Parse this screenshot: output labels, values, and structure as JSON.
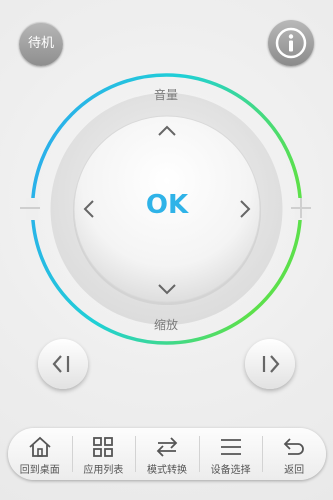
{
  "top": {
    "standby_label": "待机",
    "info_icon": "info-icon"
  },
  "dial": {
    "volume_label": "音量",
    "zoom_label": "缩放",
    "ok_label": "OK",
    "minus_icon": "minus-icon",
    "plus_icon": "plus-icon",
    "ring_colors": [
      "#2ea6f0",
      "#1fd0d6",
      "#5ce04b"
    ]
  },
  "controls": {
    "prev_icon": "prev-icon",
    "next_icon": "next-icon"
  },
  "bottom_nav": {
    "items": [
      {
        "label": "回到桌面",
        "icon": "home-icon"
      },
      {
        "label": "应用列表",
        "icon": "grid-icon"
      },
      {
        "label": "模式转换",
        "icon": "switch-icon"
      },
      {
        "label": "设备选择",
        "icon": "menu-icon"
      },
      {
        "label": "返回",
        "icon": "back-icon"
      }
    ]
  },
  "colors": {
    "accent": "#2fb3e8",
    "label_gray": "#7b7b7b"
  }
}
